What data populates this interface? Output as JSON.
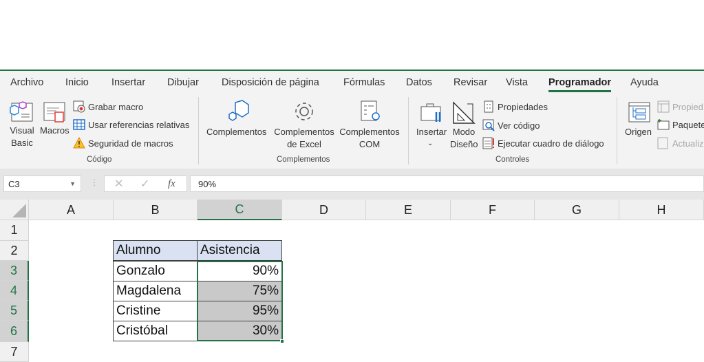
{
  "ribbon": {
    "tabs": [
      {
        "label": "Archivo"
      },
      {
        "label": "Inicio"
      },
      {
        "label": "Insertar"
      },
      {
        "label": "Dibujar"
      },
      {
        "label": "Disposición de página"
      },
      {
        "label": "Fórmulas"
      },
      {
        "label": "Datos"
      },
      {
        "label": "Revisar"
      },
      {
        "label": "Vista"
      },
      {
        "label": "Programador",
        "active": true
      },
      {
        "label": "Ayuda"
      }
    ],
    "codigo": {
      "visual_basic_1": "Visual",
      "visual_basic_2": "Basic",
      "macros": "Macros",
      "grabar": "Grabar macro",
      "referencias": "Usar referencias relativas",
      "seguridad": "Seguridad de macros",
      "group": "Código"
    },
    "complementos": {
      "complementos": "Complementos",
      "excel_1": "Complementos",
      "excel_2": "de Excel",
      "com_1": "Complementos",
      "com_2": "COM",
      "group": "Complementos"
    },
    "controles": {
      "insertar": "Insertar",
      "modo_1": "Modo",
      "modo_2": "Diseño",
      "propiedades": "Propiedades",
      "ver_codigo": "Ver código",
      "ejecutar": "Ejecutar cuadro de diálogo",
      "group": "Controles"
    },
    "xml": {
      "origen": "Origen",
      "propiedades": "Propied",
      "paquetes": "Paquete",
      "actualizar": "Actualiz"
    }
  },
  "formula_bar": {
    "name_box": "C3",
    "fx": "fx",
    "value": "90%"
  },
  "columns": [
    "A",
    "B",
    "C",
    "D",
    "E",
    "F",
    "G",
    "H"
  ],
  "rows": [
    "1",
    "2",
    "3",
    "4",
    "5",
    "6",
    "7"
  ],
  "selected_column": "C",
  "table": {
    "headers": [
      "Alumno",
      "Asistencia"
    ],
    "rows": [
      [
        "Gonzalo",
        "90%"
      ],
      [
        "Magdalena",
        "75%"
      ],
      [
        "Cristine",
        "95%"
      ],
      [
        "Cristóbal",
        "30%"
      ]
    ]
  },
  "colors": {
    "accent": "#217346",
    "header_fill": "#d9e1f2",
    "selected_fill": "#c9c9c9"
  }
}
